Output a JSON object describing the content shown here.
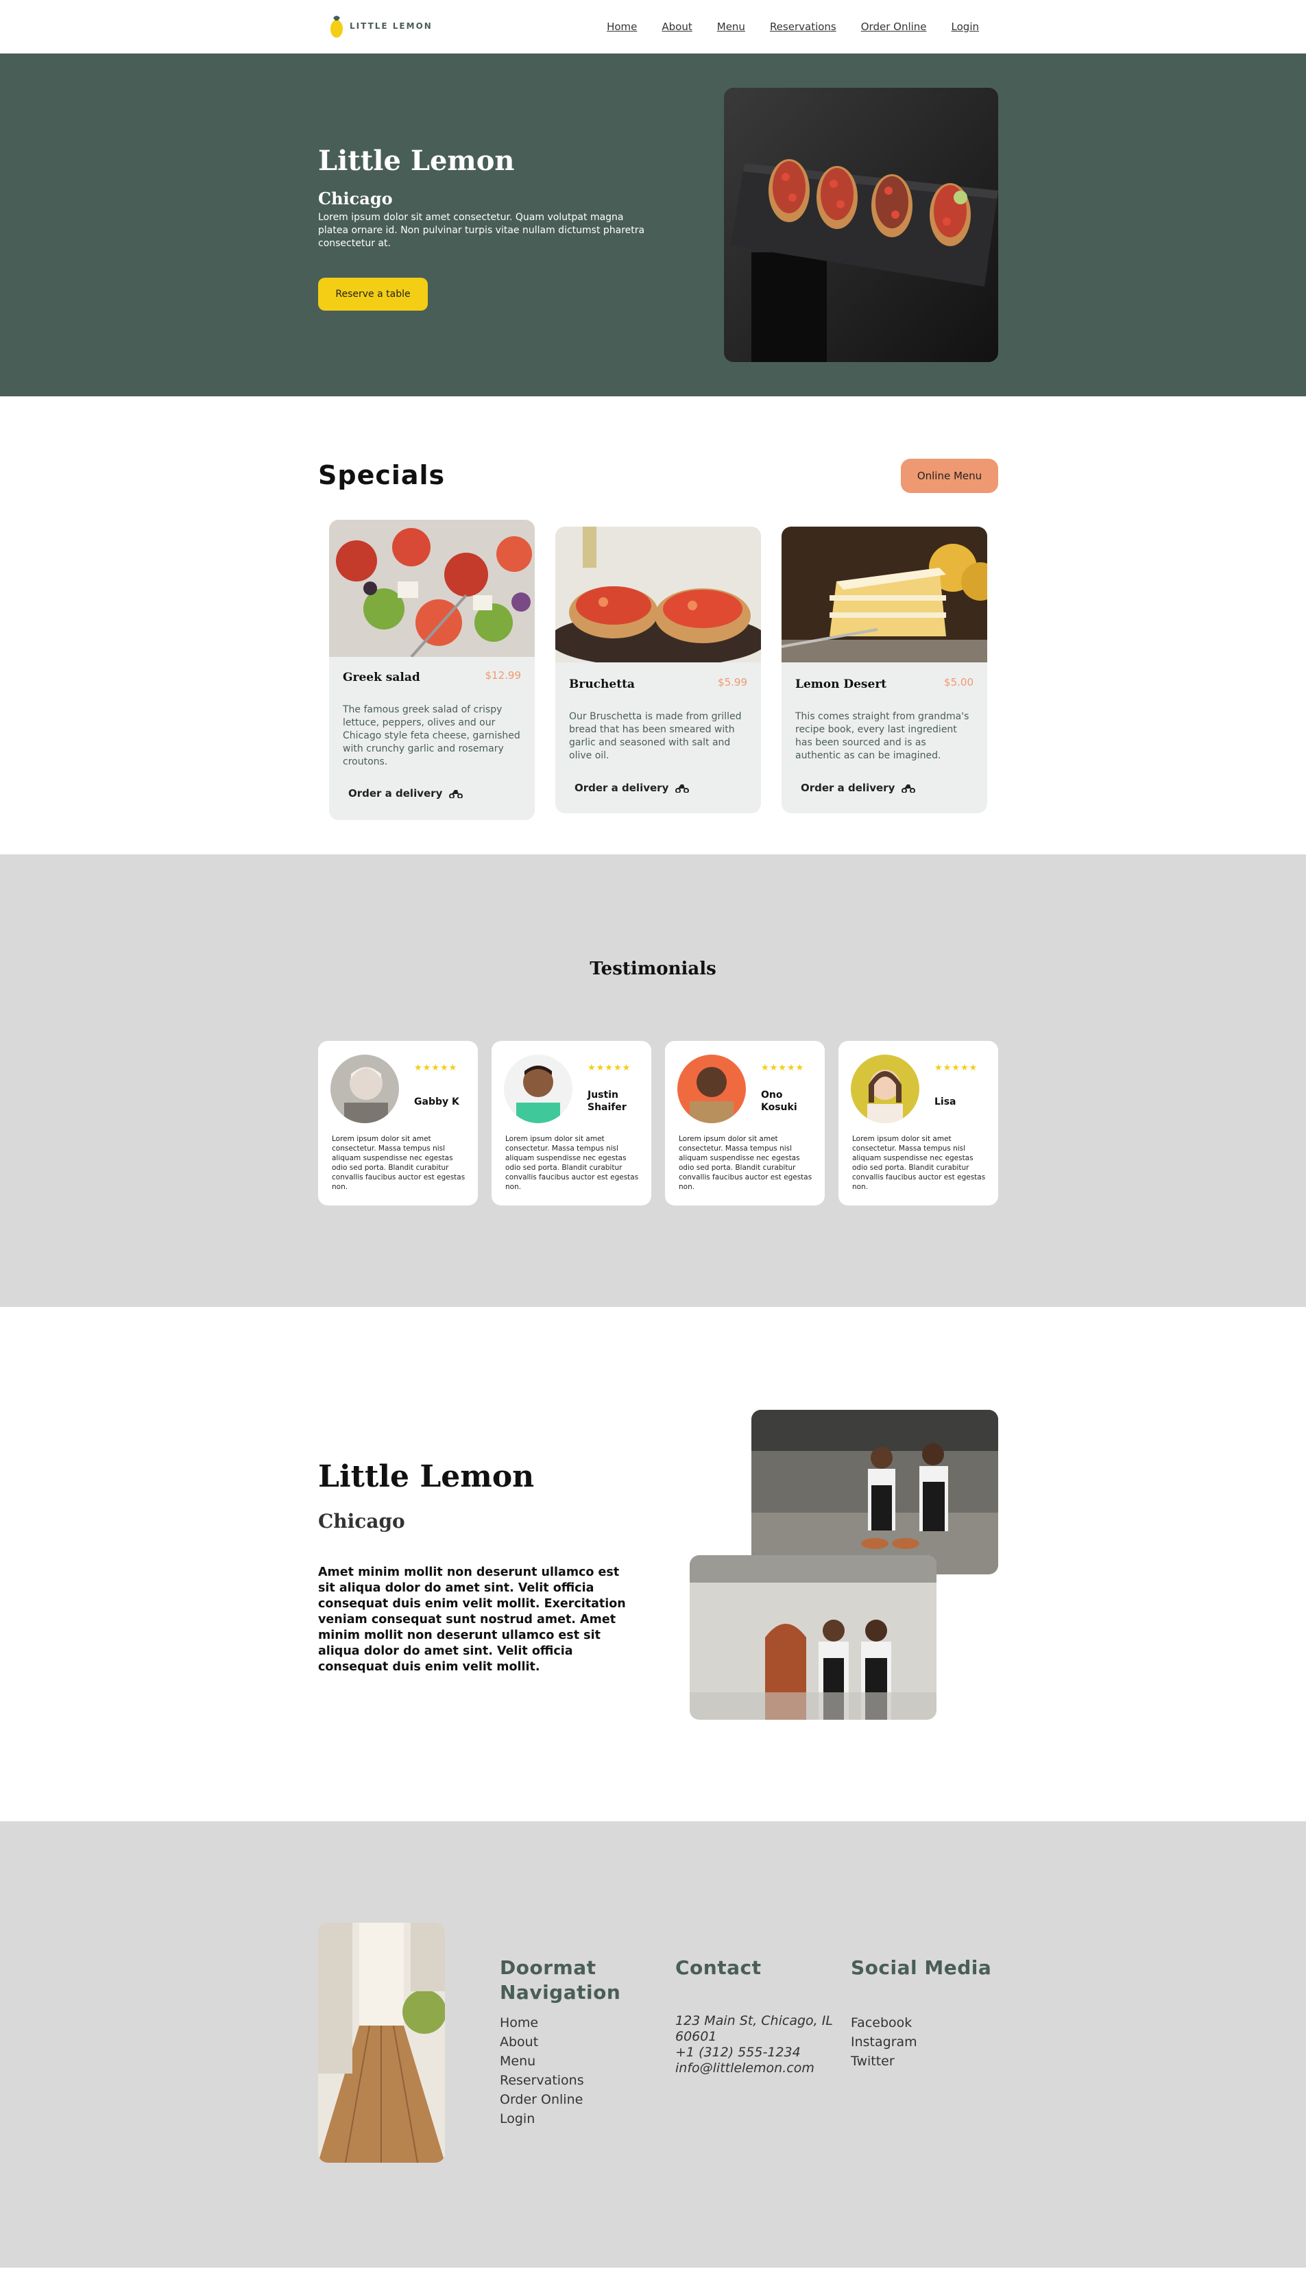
{
  "nav": {
    "logo_text": "LITTLE LEMON",
    "links": [
      "Home",
      "About",
      "Menu",
      "Reservations",
      "Order Online",
      "Login"
    ]
  },
  "hero": {
    "title": "Little Lemon",
    "subtitle": "Chicago",
    "description": "Lorem ipsum dolor sit amet consectetur. Quam volutpat magna platea ornare id. Non pulvinar turpis vitae nullam dictumst pharetra consectetur at.",
    "button": "Reserve a table"
  },
  "specials": {
    "title": "Specials",
    "menu_button": "Online Menu",
    "items": [
      {
        "name": "Greek salad",
        "price": "$12.99",
        "description": "The famous greek salad of crispy lettuce, peppers, olives and our Chicago style feta cheese, garnished with crunchy garlic and rosemary croutons.",
        "order": "Order a delivery"
      },
      {
        "name": "Bruchetta",
        "price": "$5.99",
        "description": "Our Bruschetta is made from grilled bread that has been smeared with garlic and seasoned with salt and olive oil.",
        "order": "Order a delivery"
      },
      {
        "name": "Lemon Desert",
        "price": "$5.00",
        "description": "This comes straight from grandma's recipe book, every last ingredient has been sourced and is as authentic as can be imagined.",
        "order": "Order a delivery"
      }
    ]
  },
  "testimonials": {
    "title": "Testimonials",
    "items": [
      {
        "name": "Gabby K",
        "stars": "★★★★★",
        "quote": "Lorem ipsum dolor sit amet consectetur. Massa tempus nisl aliquam suspendisse nec egestas odio sed porta. Blandit curabitur convallis faucibus auctor est egestas non."
      },
      {
        "name": "Justin Shaifer",
        "stars": "★★★★★",
        "quote": "Lorem ipsum dolor sit amet consectetur. Massa tempus nisl aliquam suspendisse nec egestas odio sed porta. Blandit curabitur convallis faucibus auctor est egestas non."
      },
      {
        "name": "Ono Kosuki",
        "stars": "★★★★★",
        "quote": "Lorem ipsum dolor sit amet consectetur. Massa tempus nisl aliquam suspendisse nec egestas odio sed porta. Blandit curabitur convallis faucibus auctor est egestas non."
      },
      {
        "name": "Lisa",
        "stars": "★★★★★",
        "quote": "Lorem ipsum dolor sit amet consectetur. Massa tempus nisl aliquam suspendisse nec egestas odio sed porta. Blandit curabitur convallis faucibus auctor est egestas non."
      }
    ]
  },
  "about": {
    "title": "Little Lemon",
    "subtitle": "Chicago",
    "text": "Amet minim mollit non deserunt ullamco est sit aliqua dolor do amet sint. Velit officia consequat duis enim velit mollit. Exercitation veniam consequat sunt nostrud amet. Amet minim mollit non deserunt ullamco est sit aliqua dolor do amet sint. Velit officia consequat duis enim velit mollit."
  },
  "footer": {
    "nav_title": "Doormat Navigation",
    "nav_links": [
      "Home",
      "About",
      "Menu",
      "Reservations",
      "Order Online",
      "Login"
    ],
    "contact_title": "Contact",
    "contact": [
      "123 Main St, Chicago, IL 60601",
      "+1 (312) 555-1234",
      "info@littlelemon.com"
    ],
    "social_title": "Social Media",
    "social": [
      "Facebook",
      "Instagram",
      "Twitter"
    ]
  },
  "colors": {
    "primary_green": "#495e57",
    "primary_yellow": "#f4ce14",
    "salmon": "#ee9972",
    "light_gray": "#edefee",
    "section_gray": "#d9d9d9"
  }
}
